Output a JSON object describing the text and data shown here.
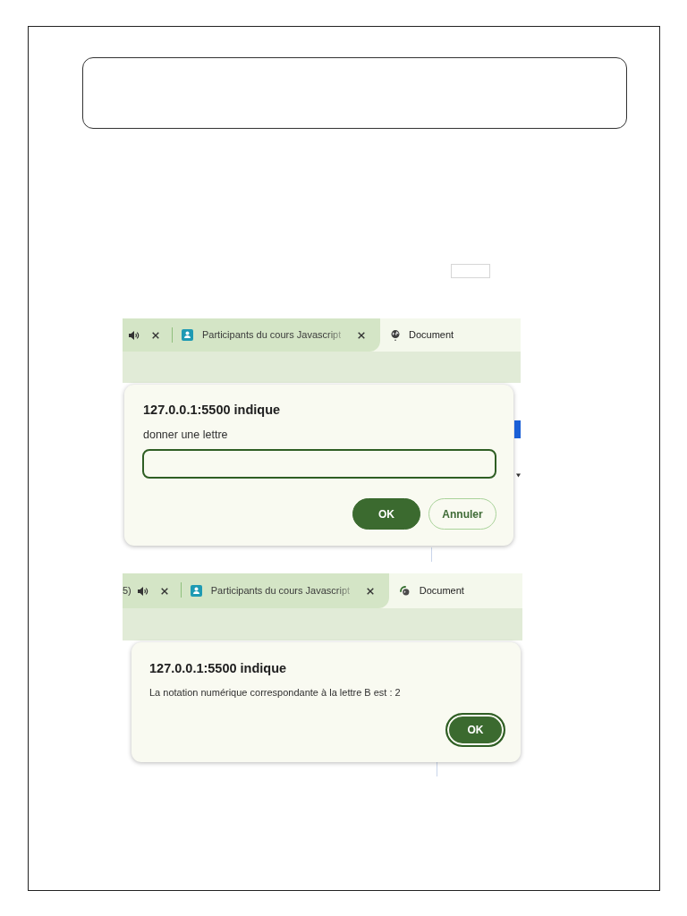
{
  "screenshots": [
    {
      "tabs": [
        {
          "kind": "audio",
          "selected": false
        },
        {
          "kind": "site",
          "label": "Participants du cours Javascript",
          "selected": false,
          "loading": false
        },
        {
          "kind": "local",
          "label": "Document",
          "selected": true,
          "loading": false
        }
      ],
      "dialog": {
        "kind": "prompt",
        "title": "127.0.0.1:5500 indique",
        "message": "donner une lettre",
        "buttons": [
          {
            "kind": "primary",
            "label": "OK",
            "focused": false
          },
          {
            "kind": "secondary",
            "label": "Annuler",
            "focused": false
          }
        ]
      }
    },
    {
      "tabs": [
        {
          "kind": "audio",
          "label": "5)",
          "selected": false
        },
        {
          "kind": "site",
          "label": "Participants du cours Javascript",
          "selected": false,
          "loading": false
        },
        {
          "kind": "local",
          "label": "Document",
          "selected": true,
          "loading": true
        }
      ],
      "dialog": {
        "kind": "alert",
        "title": "127.0.0.1:5500 indique",
        "message": "La notation numérique correspondante à la lettre B est : 2",
        "buttons": [
          {
            "kind": "primary",
            "label": "OK",
            "focused": true
          }
        ]
      }
    }
  ]
}
